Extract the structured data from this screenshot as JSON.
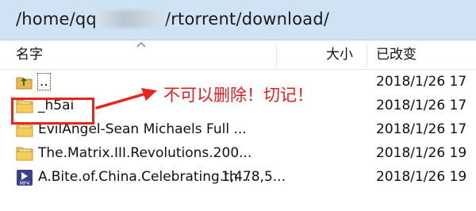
{
  "path": {
    "prefix": "/home/qq",
    "suffix": "/rtorrent/download/"
  },
  "columns": {
    "name": "名字",
    "size": "大小",
    "date": "已改变"
  },
  "rows": [
    {
      "icon": "parent-folder-icon",
      "name": "..",
      "size": "",
      "date": "2018/1/26 17"
    },
    {
      "icon": "folder-icon",
      "name": "_h5ai",
      "size": "",
      "date": "2018/1/26 17"
    },
    {
      "icon": "folder-icon",
      "name": "EvilAngel-Sean Michaels  Full ...",
      "size": "",
      "date": "2018/1/26 17"
    },
    {
      "icon": "folder-icon",
      "name": "The.Matrix.III.Revolutions.200...",
      "size": "",
      "date": "2018/1/26 19"
    },
    {
      "icon": "mp4-file-icon",
      "name": "A.Bite.of.China.Celebrating.th...",
      "size": "1,478,5...",
      "date": "2018/1/26 19"
    }
  ],
  "annotation": {
    "text": "不可以删除！切记！",
    "color": "#e51d1d"
  }
}
